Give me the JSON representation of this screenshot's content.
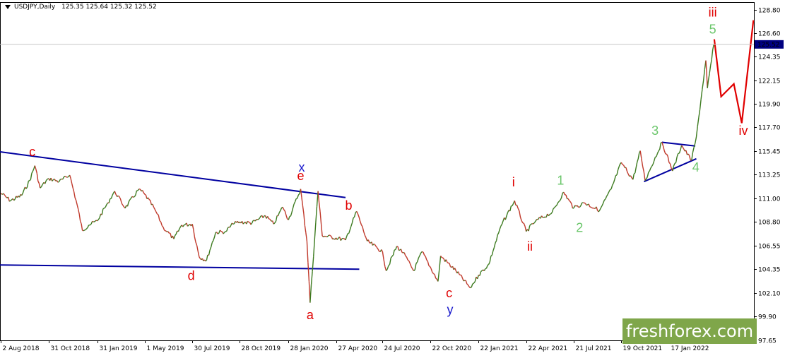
{
  "header": {
    "symbol": "USDJPY,Daily",
    "ohlc": "125.35 125.64 125.32 125.52"
  },
  "watermark": "freshforex.com",
  "chart_data": {
    "type": "line",
    "instrument": "USDJPY",
    "timeframe": "Daily",
    "last_price": "125.52",
    "colors": {
      "price": "#3b7a1e",
      "price_down": "#c0392b",
      "trendline": "#0000a0",
      "projection": "#e00000",
      "label_red": "#e00000",
      "label_green": "#6ac66a",
      "label_blue": "#1a1acc",
      "watermark": "#7fa64a",
      "price_tag": "#000080"
    },
    "y_ticks": [
      "128.80",
      "126.60",
      "124.35",
      "122.15",
      "119.90",
      "117.70",
      "115.45",
      "113.25",
      "111.00",
      "108.80",
      "106.55",
      "104.35",
      "102.10",
      "99.90",
      "97.65"
    ],
    "x_ticks": [
      "2 Aug 2018",
      "31 Oct 2018",
      "31 Jan 2019",
      "1 May 2019",
      "30 Jul 2019",
      "28 Oct 2019",
      "28 Jan 2020",
      "27 Apr 2020",
      "24 Jul 2020",
      "22 Oct 2020",
      "22 Jan 2021",
      "22 Apr 2021",
      "21 Jul 2021",
      "19 Oct 2021",
      "17 Jan 2022"
    ],
    "x_range": [
      "2018-07-31",
      "2022-06-27"
    ],
    "y_range": [
      97.65,
      129.5
    ],
    "price_series": [
      [
        "2018-08-02",
        111.5
      ],
      [
        "2018-08-20",
        110.8
      ],
      [
        "2018-09-10",
        111.3
      ],
      [
        "2018-09-25",
        112.7
      ],
      [
        "2018-10-05",
        114.1
      ],
      [
        "2018-10-15",
        112.0
      ],
      [
        "2018-10-31",
        112.9
      ],
      [
        "2018-11-20",
        112.6
      ],
      [
        "2018-12-10",
        113.2
      ],
      [
        "2018-12-24",
        110.4
      ],
      [
        "2019-01-03",
        108.0
      ],
      [
        "2019-01-15",
        108.5
      ],
      [
        "2019-01-31",
        108.9
      ],
      [
        "2019-02-20",
        110.6
      ],
      [
        "2019-03-05",
        111.7
      ],
      [
        "2019-03-25",
        110.1
      ],
      [
        "2019-04-20",
        111.9
      ],
      [
        "2019-05-01",
        111.4
      ],
      [
        "2019-05-20",
        110.0
      ],
      [
        "2019-06-05",
        108.3
      ],
      [
        "2019-06-25",
        107.2
      ],
      [
        "2019-07-10",
        108.5
      ],
      [
        "2019-07-30",
        108.6
      ],
      [
        "2019-08-12",
        105.5
      ],
      [
        "2019-08-26",
        105.2
      ],
      [
        "2019-09-12",
        107.8
      ],
      [
        "2019-10-01",
        107.9
      ],
      [
        "2019-10-15",
        108.6
      ],
      [
        "2019-10-28",
        108.8
      ],
      [
        "2019-11-20",
        108.7
      ],
      [
        "2019-12-15",
        109.4
      ],
      [
        "2019-12-31",
        108.6
      ],
      [
        "2020-01-17",
        110.2
      ],
      [
        "2020-01-28",
        109.0
      ],
      [
        "2020-02-20",
        111.9
      ],
      [
        "2020-03-03",
        107.0
      ],
      [
        "2020-03-09",
        101.2
      ],
      [
        "2020-03-24",
        111.7
      ],
      [
        "2020-04-01",
        107.5
      ],
      [
        "2020-04-27",
        107.3
      ],
      [
        "2020-05-15",
        107.1
      ],
      [
        "2020-06-05",
        109.8
      ],
      [
        "2020-06-25",
        107.0
      ],
      [
        "2020-07-24",
        106.0
      ],
      [
        "2020-07-31",
        104.2
      ],
      [
        "2020-08-20",
        106.5
      ],
      [
        "2020-09-01",
        105.9
      ],
      [
        "2020-09-21",
        104.2
      ],
      [
        "2020-10-07",
        106.0
      ],
      [
        "2020-10-22",
        104.6
      ],
      [
        "2020-11-06",
        103.2
      ],
      [
        "2020-11-11",
        105.6
      ],
      [
        "2020-12-10",
        104.2
      ],
      [
        "2021-01-06",
        102.6
      ],
      [
        "2021-01-22",
        103.8
      ],
      [
        "2021-02-10",
        104.8
      ],
      [
        "2021-03-05",
        108.4
      ],
      [
        "2021-03-31",
        110.8
      ],
      [
        "2021-04-22",
        107.9
      ],
      [
        "2021-05-10",
        108.9
      ],
      [
        "2021-06-10",
        109.7
      ],
      [
        "2021-07-02",
        111.6
      ],
      [
        "2021-07-21",
        110.1
      ],
      [
        "2021-08-10",
        110.6
      ],
      [
        "2021-09-08",
        109.9
      ],
      [
        "2021-09-30",
        111.9
      ],
      [
        "2021-10-19",
        114.4
      ],
      [
        "2021-11-10",
        112.8
      ],
      [
        "2021-11-24",
        115.5
      ],
      [
        "2021-12-03",
        112.7
      ],
      [
        "2022-01-04",
        116.3
      ],
      [
        "2022-01-24",
        113.6
      ],
      [
        "2022-02-10",
        116.0
      ],
      [
        "2022-03-01",
        114.6
      ],
      [
        "2022-03-10",
        116.8
      ],
      [
        "2022-03-28",
        124.0
      ],
      [
        "2022-03-31",
        121.4
      ],
      [
        "2022-04-12",
        125.5
      ]
    ],
    "projection": [
      [
        "2022-04-13",
        126.0
      ],
      [
        "2022-04-26",
        120.6
      ],
      [
        "2022-05-20",
        121.8
      ],
      [
        "2022-06-04",
        118.1
      ],
      [
        "2022-06-26",
        127.8
      ]
    ],
    "trendlines": [
      {
        "name": "upper-resistance",
        "from": [
          "2018-07-31",
          115.4
        ],
        "to": [
          "2020-05-15",
          111.1
        ]
      },
      {
        "name": "lower-support",
        "from": [
          "2018-07-31",
          104.75
        ],
        "to": [
          "2020-06-10",
          104.35
        ]
      },
      {
        "name": "triangle-upper",
        "from": [
          "2022-01-04",
          116.3
        ],
        "to": [
          "2022-03-08",
          115.95
        ]
      },
      {
        "name": "triangle-lower",
        "from": [
          "2021-12-01",
          112.6
        ],
        "to": [
          "2022-03-10",
          114.75
        ]
      }
    ],
    "annotations": [
      {
        "text": "c",
        "x": "2018-09-30",
        "y": 115.0,
        "color": "red"
      },
      {
        "text": "x",
        "x": "2020-02-22",
        "y": 113.55,
        "color": "blue"
      },
      {
        "text": "e",
        "x": "2020-02-20",
        "y": 112.75,
        "color": "red"
      },
      {
        "text": "b",
        "x": "2020-05-21",
        "y": 109.95,
        "color": "red"
      },
      {
        "text": "d",
        "x": "2019-07-28",
        "y": 103.35,
        "color": "red"
      },
      {
        "text": "a",
        "x": "2020-03-09",
        "y": 99.65,
        "color": "red"
      },
      {
        "text": "c",
        "x": "2020-11-27",
        "y": 101.7,
        "color": "red"
      },
      {
        "text": "y",
        "x": "2020-11-29",
        "y": 100.15,
        "color": "blue"
      },
      {
        "text": "i",
        "x": "2021-03-29",
        "y": 112.15,
        "color": "red"
      },
      {
        "text": "ii",
        "x": "2021-04-29",
        "y": 106.1,
        "color": "red"
      },
      {
        "text": "1",
        "x": "2021-06-26",
        "y": 112.3,
        "color": "green"
      },
      {
        "text": "2",
        "x": "2021-08-01",
        "y": 107.85,
        "color": "green"
      },
      {
        "text": "3",
        "x": "2021-12-22",
        "y": 117.0,
        "color": "green"
      },
      {
        "text": "4",
        "x": "2022-03-09",
        "y": 113.55,
        "color": "green"
      },
      {
        "text": "5",
        "x": "2022-04-10",
        "y": 126.55,
        "color": "green"
      },
      {
        "text": "iii",
        "x": "2022-04-10",
        "y": 128.15,
        "color": "red"
      },
      {
        "text": "iv",
        "x": "2022-06-07",
        "y": 117.0,
        "color": "red"
      }
    ]
  }
}
